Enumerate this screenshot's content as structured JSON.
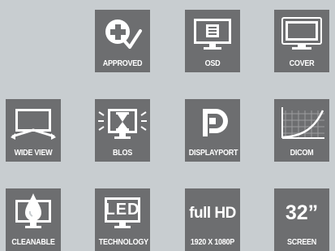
{
  "colors": {
    "background": "#c8cdd0",
    "tile": "#6d6e70",
    "foreground": "#ffffff"
  },
  "features": [
    {
      "key": "approved",
      "label": "APPROVED",
      "icon": "approved-cross-check-icon"
    },
    {
      "key": "osd",
      "label": "OSD",
      "icon": "osd-monitor-icon"
    },
    {
      "key": "cover",
      "label": "COVER",
      "icon": "cover-monitor-icon"
    },
    {
      "key": "wide-view",
      "label": "WIDE VIEW",
      "icon": "wide-view-monitor-icon"
    },
    {
      "key": "blos",
      "label": "BLOS",
      "icon": "hourglass-monitor-icon"
    },
    {
      "key": "displayport",
      "label": "DISPLAYPORT",
      "icon": "displayport-logo-icon"
    },
    {
      "key": "dicom",
      "label": "DICOM",
      "icon": "dicom-curve-icon"
    },
    {
      "key": "cleanable",
      "label": "CLEANABLE",
      "icon": "water-drop-monitor-icon"
    },
    {
      "key": "technology",
      "label": "TECHNOLOGY",
      "icon": "led-monitor-icon",
      "text": "LED"
    },
    {
      "key": "full-hd",
      "label": "1920 X 1080P",
      "text": "full HD"
    },
    {
      "key": "screen",
      "label": "SCREEN",
      "text": "32”"
    }
  ]
}
